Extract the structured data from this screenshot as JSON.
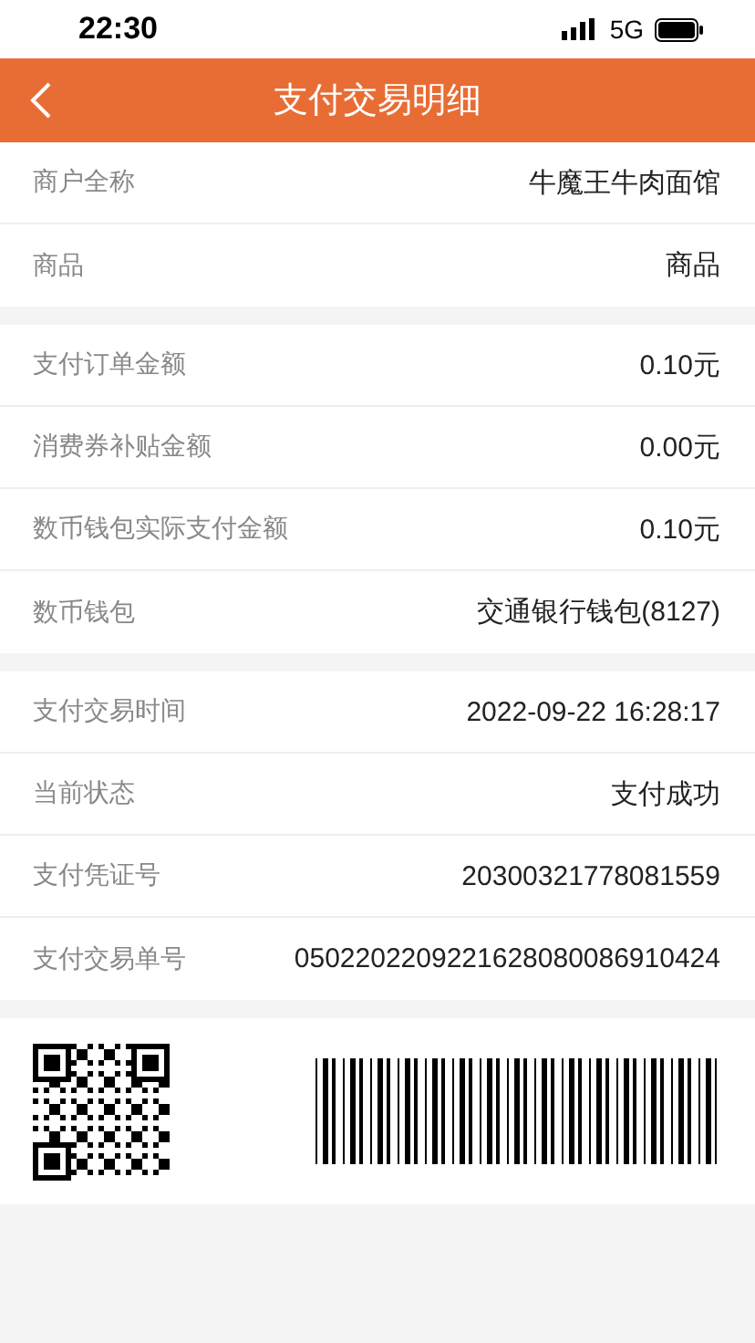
{
  "status_bar": {
    "time": "22:30",
    "network": "5G"
  },
  "header": {
    "title": "支付交易明细"
  },
  "groups": [
    [
      {
        "label": "商户全称",
        "value": "牛魔王牛肉面馆"
      },
      {
        "label": "商品",
        "value": "商品"
      }
    ],
    [
      {
        "label": "支付订单金额",
        "value": "0.10元"
      },
      {
        "label": "消费券补贴金额",
        "value": "0.00元"
      },
      {
        "label": "数币钱包实际支付金额",
        "value": "0.10元"
      },
      {
        "label": "数币钱包",
        "value": "交通银行钱包(8127)"
      }
    ],
    [
      {
        "label": "支付交易时间",
        "value": "2022-09-22 16:28:17"
      },
      {
        "label": "当前状态",
        "value": "支付成功"
      },
      {
        "label": "支付凭证号",
        "value": "20300321778081559"
      },
      {
        "label": "支付交易单号",
        "value": "0502202209221628080086910424"
      }
    ]
  ]
}
